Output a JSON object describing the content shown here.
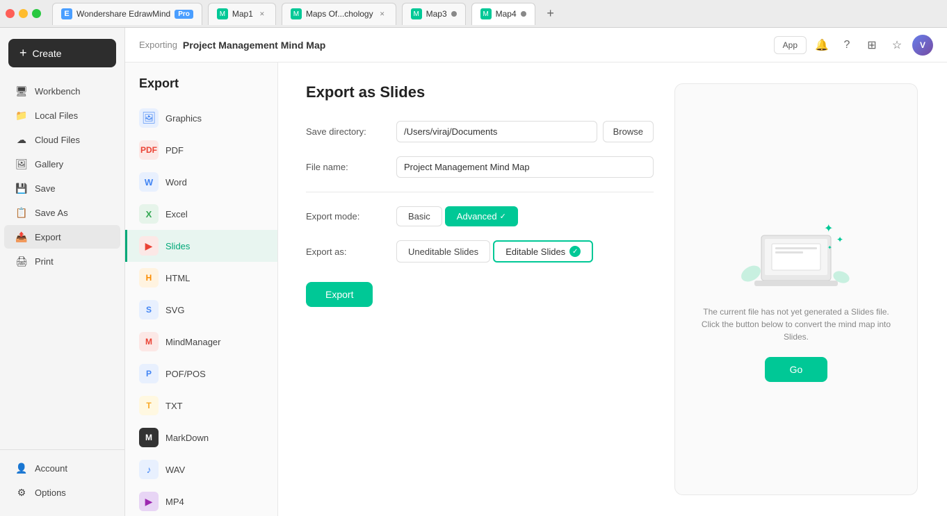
{
  "app": {
    "name": "Wondershare EdrawMind",
    "badge": "Pro"
  },
  "tabs": [
    {
      "id": "main",
      "label": "Wondershare EdrawMind",
      "pro": true,
      "active": false,
      "showClose": false
    },
    {
      "id": "map1",
      "label": "Map1",
      "active": false,
      "showClose": true
    },
    {
      "id": "maps",
      "label": "Maps Of...chology",
      "active": false,
      "showClose": true
    },
    {
      "id": "map3",
      "label": "Map3",
      "active": false,
      "showClose": false,
      "dot": true
    },
    {
      "id": "map4",
      "label": "Map4",
      "active": true,
      "showClose": false,
      "dot": true
    }
  ],
  "topbar": {
    "breadcrumb": "Exporting",
    "title": "Project Management Mind Map",
    "app_btn": "App"
  },
  "sidebar": {
    "create_label": "Create",
    "items": [
      {
        "id": "workbench",
        "label": "Workbench",
        "icon": "🖥"
      },
      {
        "id": "local-files",
        "label": "Local Files",
        "icon": "📁"
      },
      {
        "id": "cloud-files",
        "label": "Cloud Files",
        "icon": "☁"
      },
      {
        "id": "gallery",
        "label": "Gallery",
        "icon": "🖼"
      },
      {
        "id": "save",
        "label": "Save",
        "icon": "💾"
      },
      {
        "id": "save-as",
        "label": "Save As",
        "icon": "📋"
      },
      {
        "id": "export",
        "label": "Export",
        "icon": "📤",
        "active": true
      },
      {
        "id": "print",
        "label": "Print",
        "icon": "🖨"
      }
    ],
    "bottom_items": [
      {
        "id": "account",
        "label": "Account",
        "icon": "👤"
      },
      {
        "id": "options",
        "label": "Options",
        "icon": "⚙"
      }
    ]
  },
  "export_sidebar": {
    "title": "Export",
    "items": [
      {
        "id": "graphics",
        "label": "Graphics",
        "icon": "🖼",
        "color": "icon-graphics"
      },
      {
        "id": "pdf",
        "label": "PDF",
        "icon": "📄",
        "color": "icon-pdf"
      },
      {
        "id": "word",
        "label": "Word",
        "icon": "W",
        "color": "icon-word"
      },
      {
        "id": "excel",
        "label": "Excel",
        "icon": "X",
        "color": "icon-excel"
      },
      {
        "id": "slides",
        "label": "Slides",
        "icon": "▶",
        "color": "icon-slides",
        "active": true
      },
      {
        "id": "html",
        "label": "HTML",
        "icon": "H",
        "color": "icon-html"
      },
      {
        "id": "svg",
        "label": "SVG",
        "icon": "S",
        "color": "icon-svg"
      },
      {
        "id": "mindmanager",
        "label": "MindManager",
        "icon": "M",
        "color": "icon-mindmanager"
      },
      {
        "id": "pof",
        "label": "POF/POS",
        "icon": "P",
        "color": "icon-pof"
      },
      {
        "id": "txt",
        "label": "TXT",
        "icon": "T",
        "color": "icon-txt"
      },
      {
        "id": "markdown",
        "label": "MarkDown",
        "icon": "M",
        "color": "icon-markdown"
      },
      {
        "id": "wav",
        "label": "WAV",
        "icon": "♪",
        "color": "icon-wav"
      },
      {
        "id": "mp4",
        "label": "MP4",
        "icon": "▶",
        "color": "icon-mp4"
      }
    ]
  },
  "export_form": {
    "title": "Export as Slides",
    "save_directory_label": "Save directory:",
    "save_directory_value": "/Users/viraj/Documents",
    "browse_label": "Browse",
    "file_name_label": "File name:",
    "file_name_value": "Project Management Mind Map",
    "export_mode_label": "Export mode:",
    "mode_basic": "Basic",
    "mode_advanced": "Advanced",
    "export_as_label": "Export as:",
    "as_uneditable": "Uneditable Slides",
    "as_editable": "Editable Slides",
    "export_btn": "Export"
  },
  "preview": {
    "text": "The current file has not yet generated a Slides file. Click the button below to convert the mind map into Slides.",
    "go_btn": "Go"
  }
}
